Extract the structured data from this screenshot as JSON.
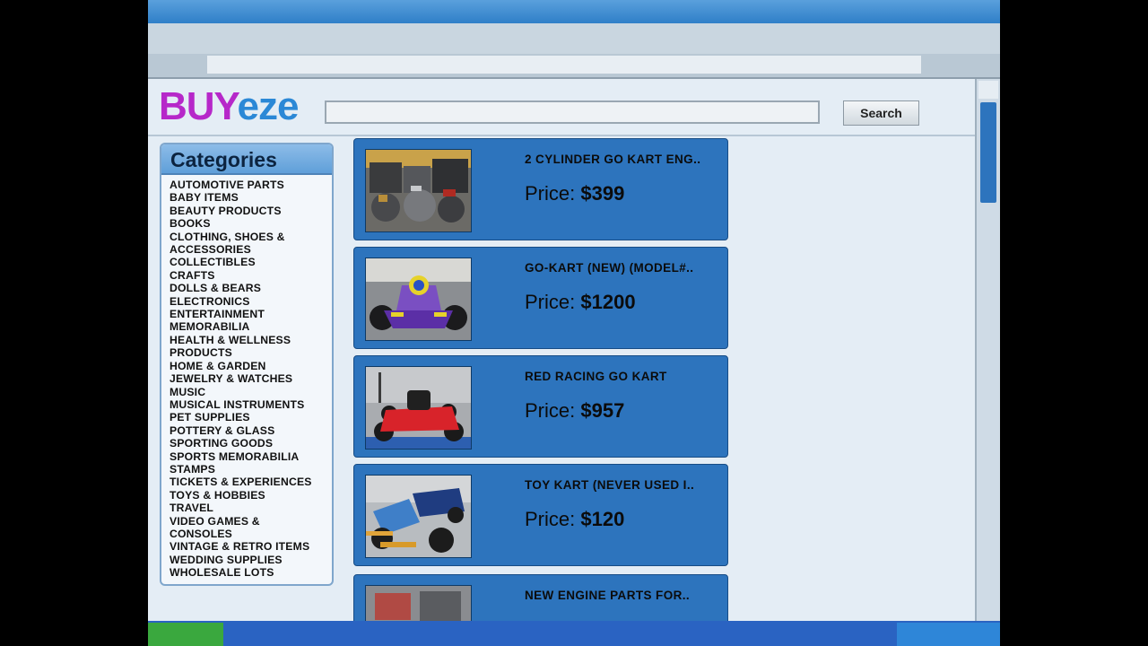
{
  "logo": {
    "part1": "BUY",
    "part2": "eze"
  },
  "search": {
    "button_label": "Search",
    "placeholder": ""
  },
  "categories": {
    "title": "Categories",
    "items": [
      "AUTOMOTIVE PARTS",
      "BABY ITEMS",
      "BEAUTY PRODUCTS",
      "BOOKS",
      "CLOTHING, SHOES &",
      "ACCESSORIES",
      "COLLECTIBLES",
      "CRAFTS",
      "DOLLS & BEARS",
      "ELECTRONICS",
      "ENTERTAINMENT",
      "MEMORABILIA",
      "HEALTH & WELLNESS",
      "PRODUCTS",
      "HOME & GARDEN",
      "JEWELRY & WATCHES",
      "MUSIC",
      "MUSICAL INSTRUMENTS",
      "PET SUPPLIES",
      "POTTERY & GLASS",
      "SPORTING GOODS",
      "SPORTS MEMORABILIA",
      "STAMPS",
      "TICKETS & EXPERIENCES",
      "TOYS & HOBBIES",
      "TRAVEL",
      "VIDEO GAMES &",
      "CONSOLES",
      "VINTAGE & RETRO ITEMS",
      "WEDDING SUPPLIES",
      "WHOLESALE LOTS"
    ]
  },
  "price_label": "Price:",
  "listings": [
    {
      "title": "2 CYLINDER GO KART ENG..",
      "price": "$399"
    },
    {
      "title": "GO-KART (NEW) (MODEL#..",
      "price": "$1200"
    },
    {
      "title": "RED RACING GO KART",
      "price": "$957"
    },
    {
      "title": "TOY KART (NEVER USED I..",
      "price": "$120"
    },
    {
      "title": "NEW ENGINE PARTS FOR..",
      "price": ""
    }
  ],
  "colors": {
    "accent": "#2d74bd",
    "logo_primary": "#b628c9",
    "logo_secondary": "#2b88d6"
  }
}
